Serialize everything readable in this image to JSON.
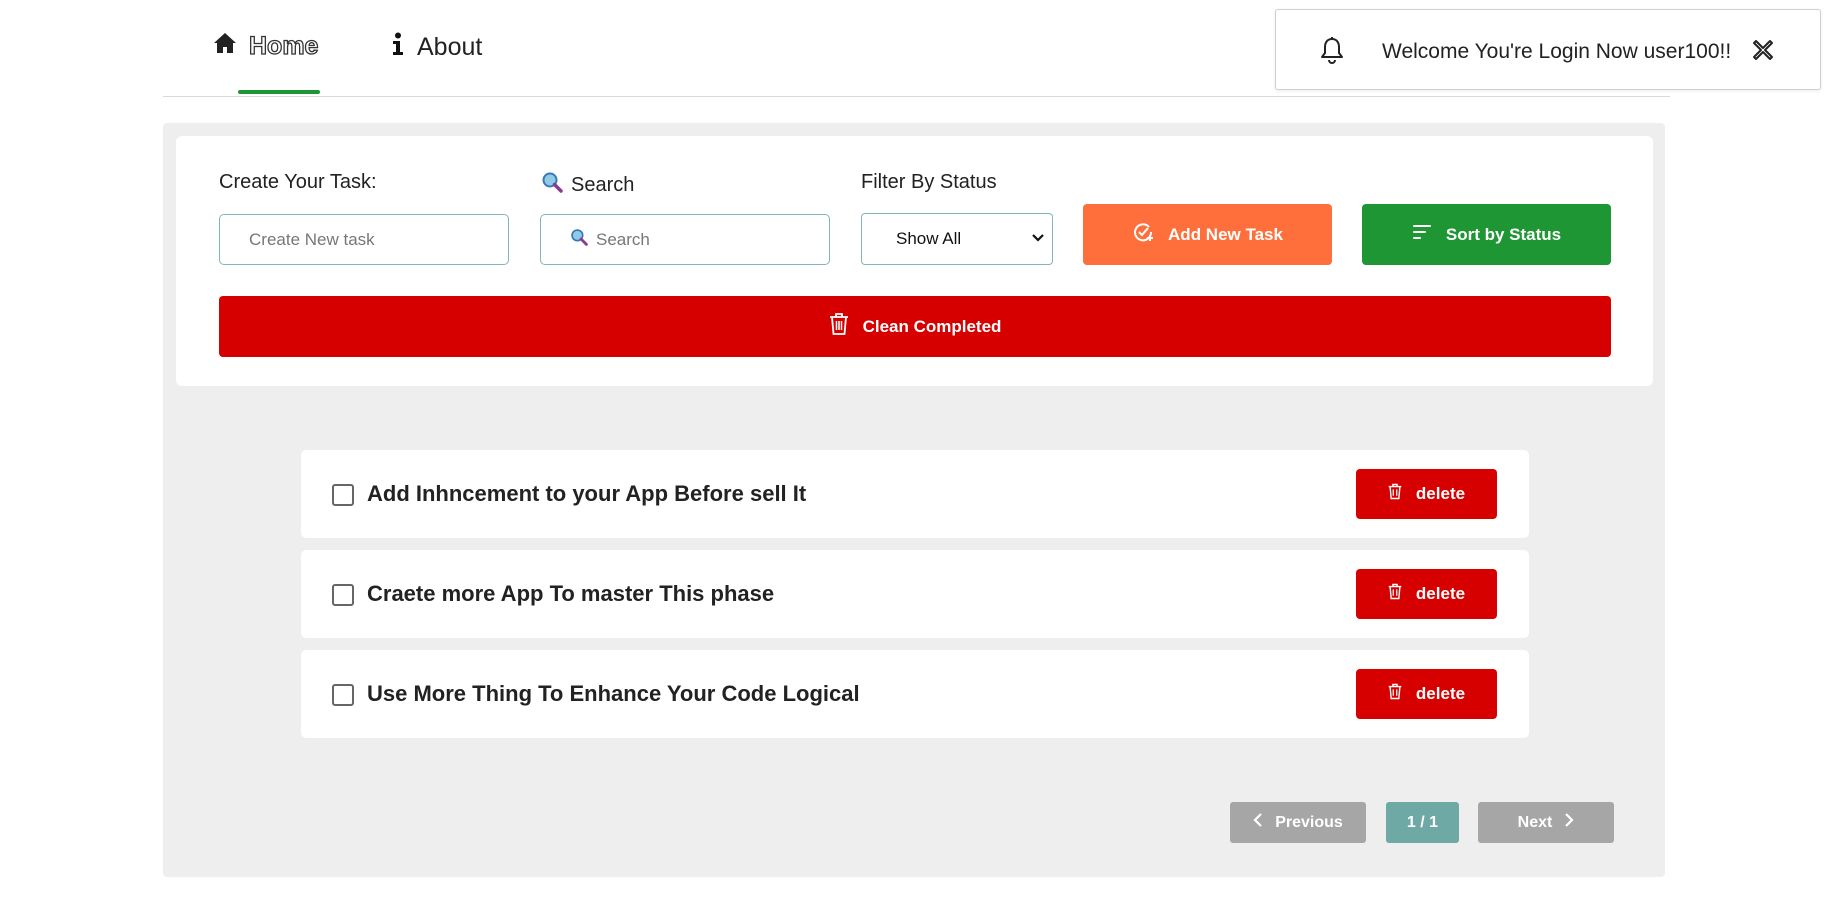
{
  "nav": {
    "home_label": "Home",
    "about_label": "About"
  },
  "toast": {
    "message": "Welcome You're Login Now user100!!"
  },
  "form": {
    "create_label": "Create Your Task:",
    "create_placeholder": "Create New task",
    "search_label": "Search",
    "search_placeholder": "Search",
    "filter_label": "Filter By Status",
    "filter_selected": "Show All",
    "add_button": "Add New Task",
    "sort_button": "Sort by Status",
    "clean_button": "Clean Completed"
  },
  "tasks": [
    {
      "title": "Add Inhncement to your App Before sell It",
      "delete_label": "delete",
      "completed": false
    },
    {
      "title": "Craete more App To master This phase",
      "delete_label": "delete",
      "completed": false
    },
    {
      "title": "Use More Thing To Enhance Your Code Logical",
      "delete_label": "delete",
      "completed": false
    }
  ],
  "pagination": {
    "previous_label": "Previous",
    "page_indicator": "1 / 1",
    "next_label": "Next"
  },
  "colors": {
    "accent_green": "#1e9633",
    "add_orange": "#ff6f3c",
    "danger_red": "#d60000",
    "page_teal": "#6fa9a6",
    "disabled_gray": "#a6a6a6"
  },
  "icons": {
    "home": "home-icon",
    "about": "info-icon",
    "toast": "bell-icon",
    "toast_close": "close-icon",
    "search_label": "magnifier-icon",
    "add": "add-task-icon",
    "sort": "sort-icon",
    "trash": "trash-icon",
    "prev": "chevron-left-icon",
    "next": "chevron-right-icon"
  }
}
